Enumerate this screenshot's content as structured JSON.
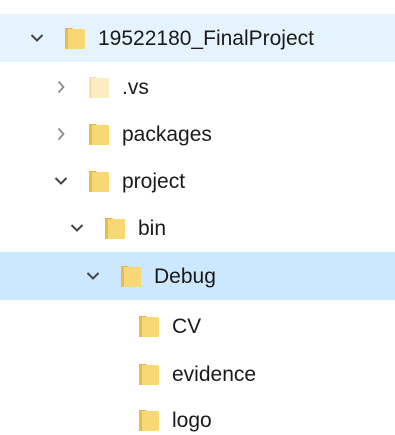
{
  "colors": {
    "selected_bg": "#cce8ff",
    "root_bg": "#e5f3ff",
    "folder_yellow": "#f8d775",
    "folder_dark": "#e0b447",
    "folder_faded": "#fbecc2",
    "chevron": "#555555"
  },
  "tree": {
    "items": [
      {
        "label": "19522180_FinalProject",
        "icon": "folder-icon",
        "expander": "chevron-down-icon"
      },
      {
        "label": ".vs",
        "icon": "folder-hidden-icon",
        "expander": "chevron-right-icon"
      },
      {
        "label": "packages",
        "icon": "folder-icon",
        "expander": "chevron-right-icon"
      },
      {
        "label": "project",
        "icon": "folder-icon",
        "expander": "chevron-down-icon"
      },
      {
        "label": "bin",
        "icon": "folder-icon",
        "expander": "chevron-down-icon"
      },
      {
        "label": "Debug",
        "icon": "folder-icon",
        "expander": "chevron-down-icon",
        "selected": true
      },
      {
        "label": "CV",
        "icon": "folder-icon",
        "expander": ""
      },
      {
        "label": "evidence",
        "icon": "folder-icon",
        "expander": ""
      },
      {
        "label": "logo",
        "icon": "folder-icon",
        "expander": ""
      }
    ]
  }
}
